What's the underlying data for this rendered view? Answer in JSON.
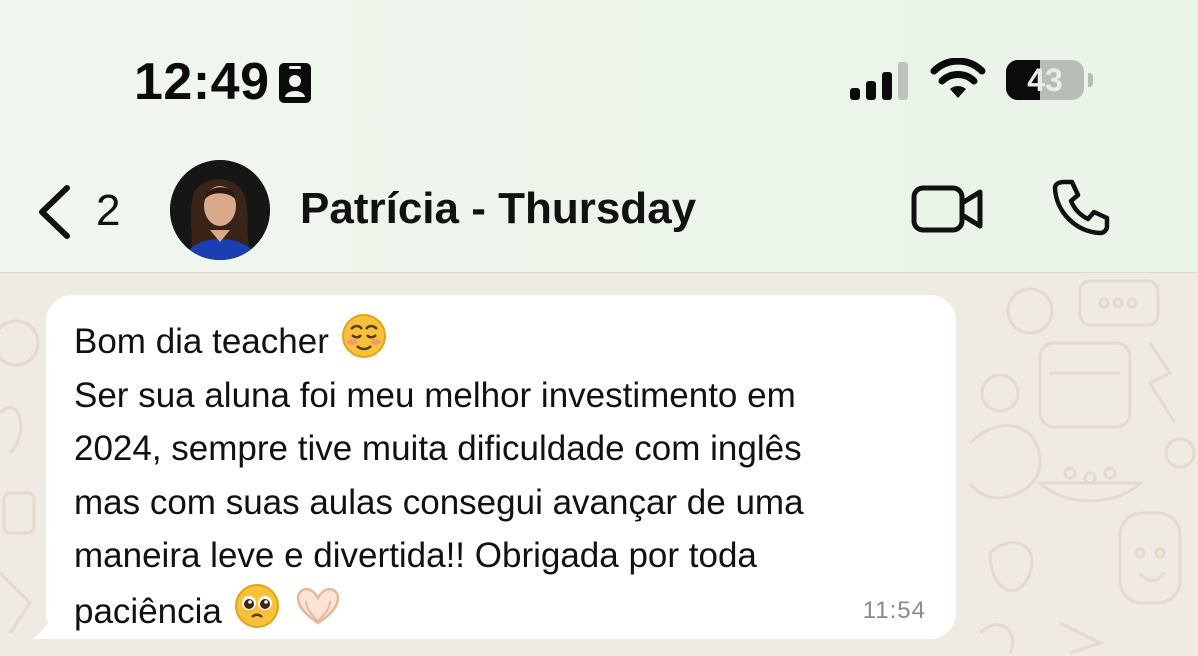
{
  "status_bar": {
    "time": "12:49",
    "battery_level": "43",
    "battery_fraction": 0.43,
    "icons": [
      "id-card-icon",
      "cellular-signal-icon",
      "wifi-icon",
      "battery-icon"
    ]
  },
  "header": {
    "back_count": "2",
    "contact_name": "Patrícia - Thursday",
    "icons": [
      "back-chevron-icon",
      "avatar",
      "video-call-icon",
      "phone-call-icon"
    ]
  },
  "message": {
    "lines": [
      "Bom dia teacher",
      "Ser sua aluna foi meu melhor investimento em",
      "2024, sempre tive muita dificuldade com inglês",
      "mas com suas aulas consegui avançar de uma",
      "maneira leve e divertida!! Obrigada por toda",
      "paciência"
    ],
    "emojis": [
      "smiling-face-emoji",
      "pleading-face-emoji",
      "heart-hands-emoji"
    ],
    "time": "11:54"
  },
  "colors": {
    "header_bg": "#ecf5ea",
    "chat_bg": "#efeae2",
    "bubble_bg": "#ffffff",
    "text": "#111111",
    "timestamp": "#8b8b8b"
  }
}
